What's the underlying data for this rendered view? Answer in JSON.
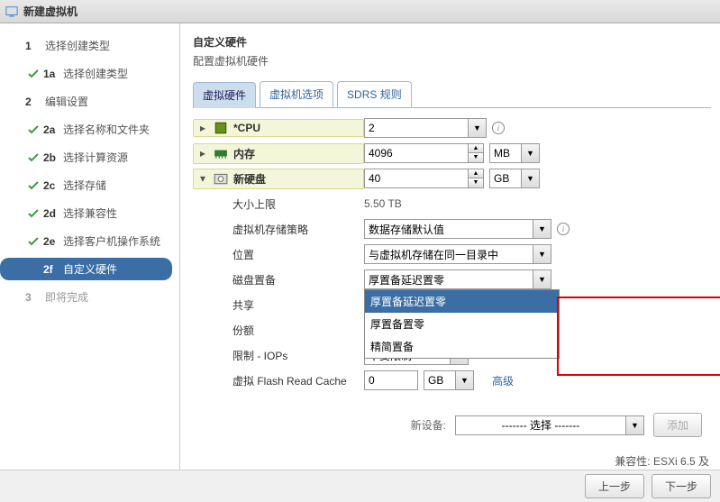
{
  "window": {
    "title": "新建虚拟机"
  },
  "sidebar": {
    "items": [
      {
        "num": "1",
        "label": "选择创建类型",
        "check": false,
        "main": true
      },
      {
        "num": "1a",
        "label": "选择创建类型",
        "check": true
      },
      {
        "num": "2",
        "label": "编辑设置",
        "check": false,
        "main": true
      },
      {
        "num": "2a",
        "label": "选择名称和文件夹",
        "check": true
      },
      {
        "num": "2b",
        "label": "选择计算资源",
        "check": true
      },
      {
        "num": "2c",
        "label": "选择存储",
        "check": true
      },
      {
        "num": "2d",
        "label": "选择兼容性",
        "check": true
      },
      {
        "num": "2e",
        "label": "选择客户机操作系统",
        "check": true
      },
      {
        "num": "2f",
        "label": "自定义硬件",
        "check": false,
        "active": true
      },
      {
        "num": "3",
        "label": "即将完成",
        "check": false,
        "dim": true
      }
    ]
  },
  "section": {
    "title": "自定义硬件",
    "desc": "配置虚拟机硬件"
  },
  "tabs": {
    "t1": "虚拟硬件",
    "t2": "虚拟机选项",
    "t3": "SDRS 规则"
  },
  "rows": {
    "cpu": {
      "label": "*CPU",
      "value": "2"
    },
    "mem": {
      "label": "内存",
      "value": "4096",
      "unit": "MB"
    },
    "disk": {
      "label": "新硬盘",
      "value": "40",
      "unit": "GB"
    },
    "maxsize": {
      "label": "大小上限",
      "value": "5.50 TB"
    },
    "policy": {
      "label": "虚拟机存储策略",
      "value": "数据存储默认值"
    },
    "location": {
      "label": "位置",
      "value": "与虚拟机存储在同一目录中"
    },
    "provision": {
      "label": "磁盘置备",
      "value": "厚置备延迟置零",
      "options": [
        "厚置备延迟置零",
        "厚置备置零",
        "精简置备"
      ]
    },
    "share": {
      "label": "共享"
    },
    "shares2": {
      "label": "份额"
    },
    "iops": {
      "label": "限制 - IOPs",
      "value": "不受限制"
    },
    "flash": {
      "label": "虚拟 Flash Read Cache",
      "value": "0",
      "unit": "GB",
      "adv": "高级"
    }
  },
  "device": {
    "label": "新设备:",
    "select": "------- 选择 -------",
    "add": "添加"
  },
  "compat": "兼容性: ESXi 6.5 及",
  "footer": {
    "back": "上一步",
    "next": "下一步"
  }
}
